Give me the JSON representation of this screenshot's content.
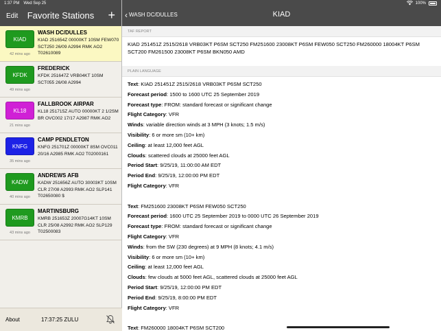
{
  "status": {
    "time": "1:37 PM",
    "date": "Wed Sep 25",
    "battery": "100%"
  },
  "sidebar": {
    "edit_label": "Edit",
    "title": "Favorite Stations",
    "add_label": "+",
    "stations": [
      {
        "code": "KIAD",
        "color": "#1f9a1f",
        "name": "WASH DC/DULLES",
        "metar": "KIAD 251654Z 00000KT 10SM FEW070 SCT250 26/09 A2994 RMK AO2 T02610089",
        "age": "42 mins ago"
      },
      {
        "code": "KFDK",
        "color": "#1f9a1f",
        "name": "FREDERICK",
        "metar": "KFDK 251647Z VRB04KT 10SM SCT055 26/08 A2994",
        "age": "49 mins ago"
      },
      {
        "code": "KL18",
        "color": "#d020d6",
        "name": "FALLBROOK AIRPAR",
        "metar": "KL18 251715Z AUTO 00000KT 2 1/2SM BR OVC002 17/17 A2987 RMK AO2",
        "age": "21 mins ago"
      },
      {
        "code": "KNFG",
        "color": "#1d22e6",
        "name": "CAMP PENDLETON",
        "metar": "KNFG 251701Z 00000KT 8SM OVC011 20/16 A2985 RMK AO2 T02000161",
        "age": "35 mins ago"
      },
      {
        "code": "KADW",
        "color": "#1f9a1f",
        "name": "ANDREWS AFB",
        "metar": "KADW 251656Z AUTO 30003KT 10SM CLR 27/08 A2993 RMK AO2 SLP141 T02650080 $",
        "age": "40 mins ago"
      },
      {
        "code": "KMRB",
        "color": "#1f9a1f",
        "name": "MARTINSBURG",
        "metar": "KMRB 251653Z 20007G14KT 10SM CLR 25/08 A2992 RMK AO2 SLP129 T02500083",
        "age": "43 mins ago"
      }
    ],
    "footer": {
      "about_label": "About",
      "clock": "17:37:25 ZULU"
    }
  },
  "main": {
    "back_label": "WASH DC/DULLES",
    "title": "KIAD",
    "taf_header": "TAF REPORT",
    "taf_text": "KIAD 251451Z 2515/2618 VRB03KT P6SM SCT250 FM251600 23008KT P6SM FEW050 SCT250 FM260000 18004KT P6SM SCT200 FM261500 23008KT P6SM BKN050  AMD",
    "plain_header": "PLAIN LANGUAGE",
    "groups": [
      [
        {
          "label": "Text",
          "value": ": KIAD 251451Z 2515/2618 VRB03KT P6SM SCT250"
        },
        {
          "label": "Forecast period",
          "value": ": 1500 to 1600 UTC 25 September 2019"
        },
        {
          "label": "Forecast type",
          "value": ": FROM: standard forecast or significant change"
        },
        {
          "label": "Flight Category",
          "value": ": VFR"
        },
        {
          "label": "Winds",
          "value": ": variable direction winds at  3 MPH (3 knots; 1.5 m/s)"
        },
        {
          "label": "Visibility",
          "value": ": 6 or more sm (10+ km)"
        },
        {
          "label": "Ceiling",
          "value": ": at least 12,000 feet AGL"
        },
        {
          "label": "Clouds",
          "value": ": scattered clouds at 25000 feet AGL"
        },
        {
          "label": "Period Start",
          "value": ": 9/25/19, 11:00:00 AM EDT"
        },
        {
          "label": "Period End",
          "value": ": 9/25/19, 12:00:00 PM EDT"
        },
        {
          "label": "Flight Category",
          "value": ": VFR"
        }
      ],
      [
        {
          "label": "Text",
          "value": ": FM251600 23008KT P6SM FEW050 SCT250"
        },
        {
          "label": "Forecast period",
          "value": ": 1600 UTC 25 September 2019 to 0000 UTC 26 September 2019"
        },
        {
          "label": "Forecast type",
          "value": ": FROM: standard forecast or significant change"
        },
        {
          "label": "Flight Category",
          "value": ": VFR"
        },
        {
          "label": "Winds",
          "value": ": from the SW (230 degrees) at  9 MPH (8 knots; 4.1 m/s)"
        },
        {
          "label": "Visibility",
          "value": ": 6 or more sm (10+ km)"
        },
        {
          "label": "Ceiling",
          "value": ": at least 12,000 feet AGL"
        },
        {
          "label": "Clouds",
          "value": ": few clouds at 5000 feet AGL, scattered clouds at 25000 feet AGL"
        },
        {
          "label": "Period Start",
          "value": ": 9/25/19, 12:00:00 PM EDT"
        },
        {
          "label": "Period End",
          "value": ": 9/25/19, 8:00:00 PM EDT"
        },
        {
          "label": "Flight Category",
          "value": ": VFR"
        }
      ],
      [
        {
          "label": "Text",
          "value": ": FM260000 18004KT P6SM SCT200"
        }
      ]
    ]
  }
}
